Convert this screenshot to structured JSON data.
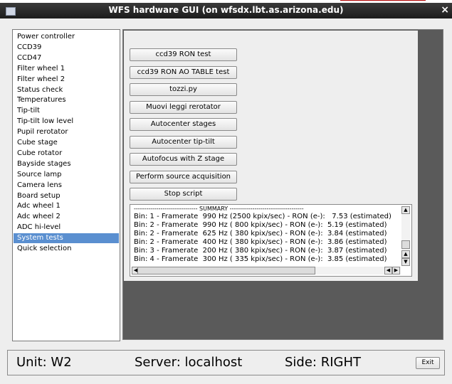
{
  "window": {
    "title": "WFS hardware GUI (on wfsdx.lbt.as.arizona.edu)",
    "close_glyph": "×"
  },
  "sidebar": {
    "items": [
      "Power controller",
      "CCD39",
      "CCD47",
      "Filter wheel 1",
      "Filter wheel 2",
      "Status check",
      "Temperatures",
      "Tip-tilt",
      "Tip-tilt low level",
      "Pupil rerotator",
      "Cube stage",
      "Cube rotator",
      "Bayside stages",
      "Source lamp",
      "Camera lens",
      "Board setup",
      "Adc wheel 1",
      "Adc wheel 2",
      "ADC hi-level",
      "System tests",
      "Quick selection"
    ],
    "selected": "System tests"
  },
  "buttons": [
    "ccd39 RON test",
    "ccd39 RON AO TABLE test",
    "tozzi.py",
    "Muovi leggi rerotator",
    "Autocenter stages",
    "Autocenter tip-tilt",
    "Autofocus with Z stage",
    "Perform source acquisition",
    "Stop script"
  ],
  "summary": {
    "header": "------------------------------- SUMMARY ------------------------------------",
    "lines": [
      "Bin: 1 - Framerate  990 Hz (2500 kpix/sec) - RON (e-):   7.53 (estimated)",
      "Bin: 2 - Framerate  990 Hz ( 800 kpix/sec) - RON (e-):  5.19 (estimated)",
      "Bin: 2 - Framerate  625 Hz ( 380 kpix/sec) - RON (e-):  3.84 (estimated)",
      "Bin: 2 - Framerate  400 Hz ( 380 kpix/sec) - RON (e-):  3.86 (estimated)",
      "Bin: 3 - Framerate  200 Hz ( 380 kpix/sec) - RON (e-):  3.87 (estimated)",
      "Bin: 4 - Framerate  300 Hz ( 335 kpix/sec) - RON (e-):  3.85 (estimated)"
    ]
  },
  "status": {
    "unit": "Unit: W2",
    "server": "Server: localhost",
    "side": "Side: RIGHT",
    "exit_label": "Exit"
  },
  "icons": {
    "up": "▲",
    "down": "▼",
    "left": "◀",
    "right": "▶"
  },
  "colors": {
    "selection": "#5a8fd0",
    "titlebar": "#2a2a2a",
    "panel_background": "#5a5a5a"
  }
}
